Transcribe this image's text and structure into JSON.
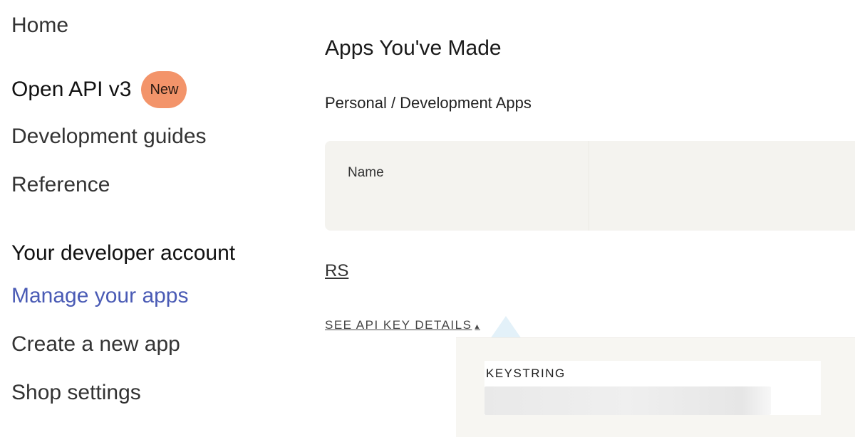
{
  "sidebar": {
    "items": [
      {
        "label": "Home"
      },
      {
        "label": "Open API v3",
        "badge": "New"
      },
      {
        "label": "Development guides"
      },
      {
        "label": "Reference"
      }
    ],
    "account_heading": "Your developer account",
    "account_items": [
      {
        "label": "Manage your apps",
        "active": true
      },
      {
        "label": "Create a new app"
      },
      {
        "label": "Shop settings"
      }
    ]
  },
  "main": {
    "title": "Apps You've Made",
    "section_title": "Personal / Development Apps",
    "table": {
      "columns": [
        "Name"
      ]
    },
    "app": {
      "name": "RS",
      "api_key_link": "SEE API KEY DETAILS"
    },
    "popover": {
      "keystring_label": "KEYSTRING",
      "keystring_value": ""
    }
  },
  "colors": {
    "active_link": "#4a5bb5",
    "badge_bg": "#f3946a",
    "table_header_bg": "#f4f3ef",
    "popover_bg": "#f7f6f2"
  }
}
